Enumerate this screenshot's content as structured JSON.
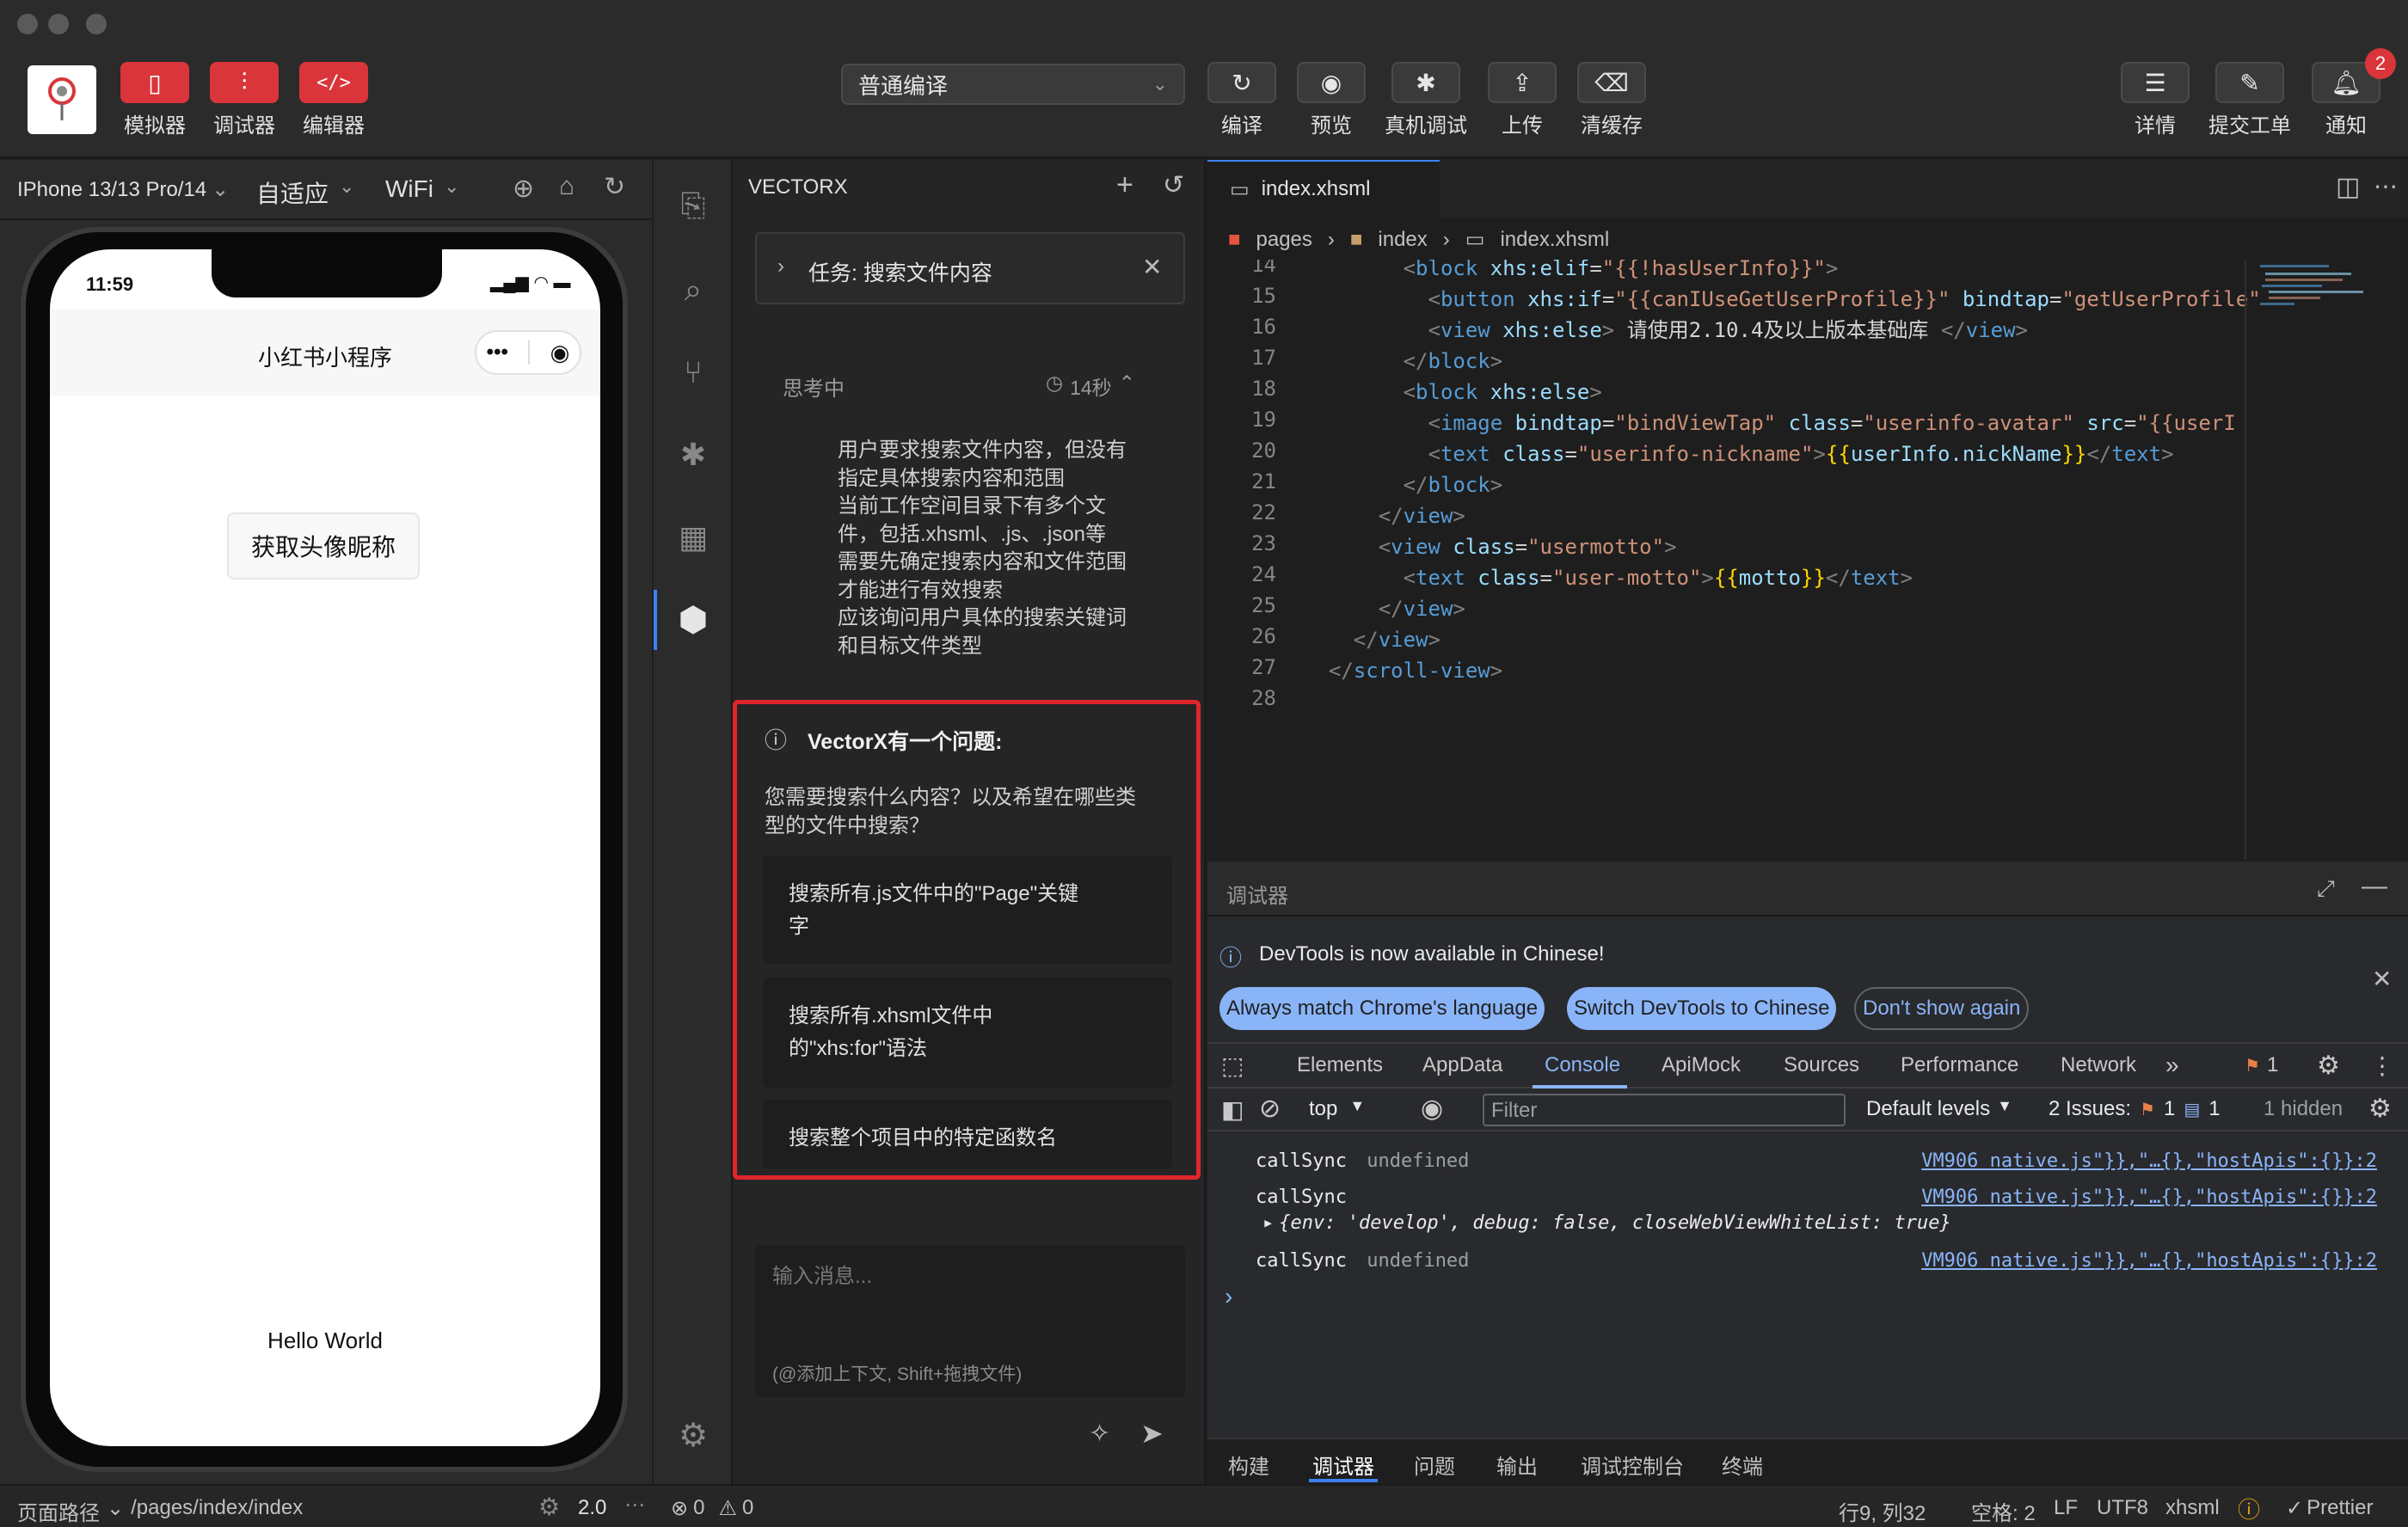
{
  "toolbar": {
    "left_buttons": [
      {
        "label": "模拟器",
        "icon": "phone-icon"
      },
      {
        "label": "调试器",
        "icon": "sliders-icon"
      },
      {
        "label": "编辑器",
        "icon": "code-icon"
      }
    ],
    "compile_mode": "普通编译",
    "mid_buttons": [
      {
        "label": "编译",
        "icon": "refresh-icon"
      },
      {
        "label": "预览",
        "icon": "eye-icon"
      },
      {
        "label": "真机调试",
        "icon": "bug-icon"
      },
      {
        "label": "上传",
        "icon": "upload-icon"
      },
      {
        "label": "清缓存",
        "icon": "clear-icon"
      }
    ],
    "right_buttons": [
      {
        "label": "详情",
        "icon": "menu-icon"
      },
      {
        "label": "提交工单",
        "icon": "ticket-icon"
      },
      {
        "label": "通知",
        "icon": "bell-icon"
      }
    ],
    "notification_count": "2"
  },
  "simulator": {
    "device": "IPhone 13/13 Pro/14",
    "scale": "自适应",
    "network": "WiFi",
    "time": "11:59",
    "app_title": "小红书小程序",
    "button_label": "获取头像昵称",
    "hello": "Hello World"
  },
  "chat": {
    "header": "VECTORX",
    "task_label": "任务: 搜索文件内容",
    "thinking_label": "思考中",
    "thinking_time": "14秒",
    "thinking_lines": [
      "用户要求搜索文件内容，但没有",
      "指定具体搜索内容和范围",
      "当前工作空间目录下有多个文",
      "件，包括.xhsml、.js、.json等",
      "需要先确定搜索内容和文件范围",
      "才能进行有效搜索",
      "应该询问用户具体的搜索关键词",
      "和目标文件类型"
    ],
    "question_title": "VectorX有一个问题:",
    "question_lines": [
      "您需要搜索什么内容？以及希望在哪些类",
      "型的文件中搜索？"
    ],
    "options": [
      [
        "搜索所有.js文件中的\"Page\"关键",
        "字"
      ],
      [
        "搜索所有.xhsml文件中",
        "的\"xhs:for\"语法"
      ],
      [
        "搜索整个项目中的特定函数名"
      ]
    ],
    "input_placeholder": "输入消息...",
    "input_hint": "(@添加上下文, Shift+拖拽文件)"
  },
  "editor": {
    "tab": "index.xhsml",
    "breadcrumb": [
      "pages",
      "index",
      "index.xhsml"
    ],
    "line_numbers": [
      "14",
      "15",
      "16",
      "17",
      "18",
      "19",
      "20",
      "21",
      "22",
      "23",
      "24",
      "25",
      "26",
      "27",
      "28"
    ]
  },
  "debugger": {
    "title": "调试器",
    "banner": "DevTools is now available in Chinese!",
    "banner_buttons": [
      "Always match Chrome's language",
      "Switch DevTools to Chinese",
      "Don't show again"
    ],
    "tabs": [
      "Elements",
      "AppData",
      "Console",
      "ApiMock",
      "Sources",
      "Performance",
      "Network"
    ],
    "active_tab": "Console",
    "issue_badge": "1",
    "context": "top",
    "filter_placeholder": "Filter",
    "levels": "Default levels",
    "issues_label": "2 Issues:",
    "issues_warn": "1",
    "issues_info": "1",
    "hidden": "1 hidden",
    "logs": [
      {
        "name": "callSync",
        "value": "undefined",
        "src": "VM906 native.js\"}},\"…{},\"hostApis\":{}}:2"
      },
      {
        "name": "callSync",
        "value": "",
        "src": "VM906 native.js\"}},\"…{},\"hostApis\":{}}:2"
      },
      {
        "name": "callSync",
        "value": "undefined",
        "src": "VM906 native.js\"}},\"…{},\"hostApis\":{}}:2"
      }
    ],
    "object_preview": "{env: 'develop', debug: false, closeWebViewWhiteList: true}"
  },
  "panel_tabs": [
    "构建",
    "调试器",
    "问题",
    "输出",
    "调试控制台",
    "终端"
  ],
  "active_panel_tab": "调试器",
  "status": {
    "path_label": "页面路径",
    "path": "/pages/index/index",
    "version": "2.0",
    "errors": "0",
    "warnings": "0",
    "position": "行9, 列32",
    "spaces": "空格: 2",
    "eol": "LF",
    "encoding": "UTF8",
    "language": "xhsml",
    "formatter": "Prettier"
  },
  "colors": {
    "accent_red": "#d9353a",
    "highlight_border": "#e0262c",
    "devtools_blue": "#8ab4f8"
  }
}
